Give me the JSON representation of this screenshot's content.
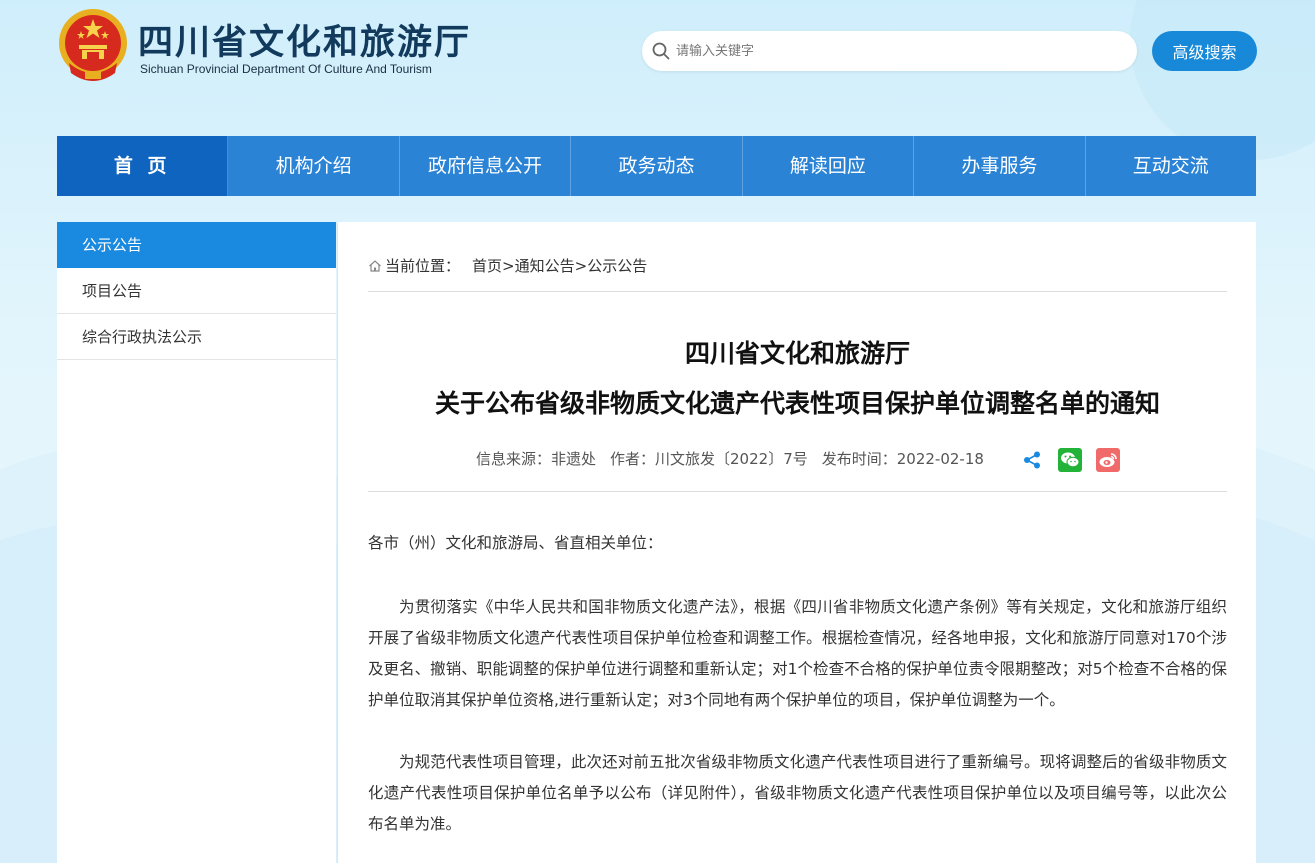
{
  "site": {
    "title": "四川省文化和旅游厅",
    "subtitle": "Sichuan Provincial Department Of Culture And Tourism"
  },
  "search": {
    "placeholder": "请输入关键字",
    "advanced_label": "高级搜索"
  },
  "nav": {
    "items": [
      "首 页",
      "机构介绍",
      "政府信息公开",
      "政务动态",
      "解读回应",
      "办事服务",
      "互动交流"
    ]
  },
  "sidebar": {
    "items": [
      "公示公告",
      "项目公告",
      "综合行政执法公示"
    ]
  },
  "breadcrumb": {
    "prefix": "当前位置：",
    "items": [
      "首页",
      "通知公告",
      "公示公告"
    ],
    "separator": ">"
  },
  "article": {
    "title_line1": "四川省文化和旅游厅",
    "title_line2": "关于公布省级非物质文化遗产代表性项目保护单位调整名单的通知",
    "source": "信息来源：非遗处",
    "author": "作者：川文旅发〔2022〕7号",
    "date": "发布时间：2022-02-18",
    "salutation": "各市（州）文化和旅游局、省直相关单位：",
    "paragraphs": [
      "为贯彻落实《中华人民共和国非物质文化遗产法》，根据《四川省非物质文化遗产条例》等有关规定，文化和旅游厅组织开展了省级非物质文化遗产代表性项目保护单位检查和调整工作。根据检查情况，经各地申报，文化和旅游厅同意对170个涉及更名、撤销、职能调整的保护单位进行调整和重新认定；对1个检查不合格的保护单位责令限期整改；对5个检查不合格的保护单位取消其保护单位资格,进行重新认定；对3个同地有两个保护单位的项目，保护单位调整为一个。",
      "为规范代表性项目管理，此次还对前五批次省级非物质文化遗产代表性项目进行了重新编号。现将调整后的省级非物质文化遗产代表性项目保护单位名单予以公布（详见附件），省级非物质文化遗产代表性项目保护单位以及项目编号等，以此次公布名单为准。"
    ]
  },
  "colors": {
    "nav_bg": "#2b83d6",
    "nav_active": "#0f64c0",
    "sidebar_active": "#1a8ae0",
    "button": "#1789d8",
    "wechat": "#22b338",
    "weibo": "#f06a6a",
    "share": "#1a8ae0"
  },
  "icons": [
    "national-emblem-icon",
    "search-icon",
    "home-icon",
    "share-icon",
    "wechat-icon",
    "weibo-icon"
  ]
}
